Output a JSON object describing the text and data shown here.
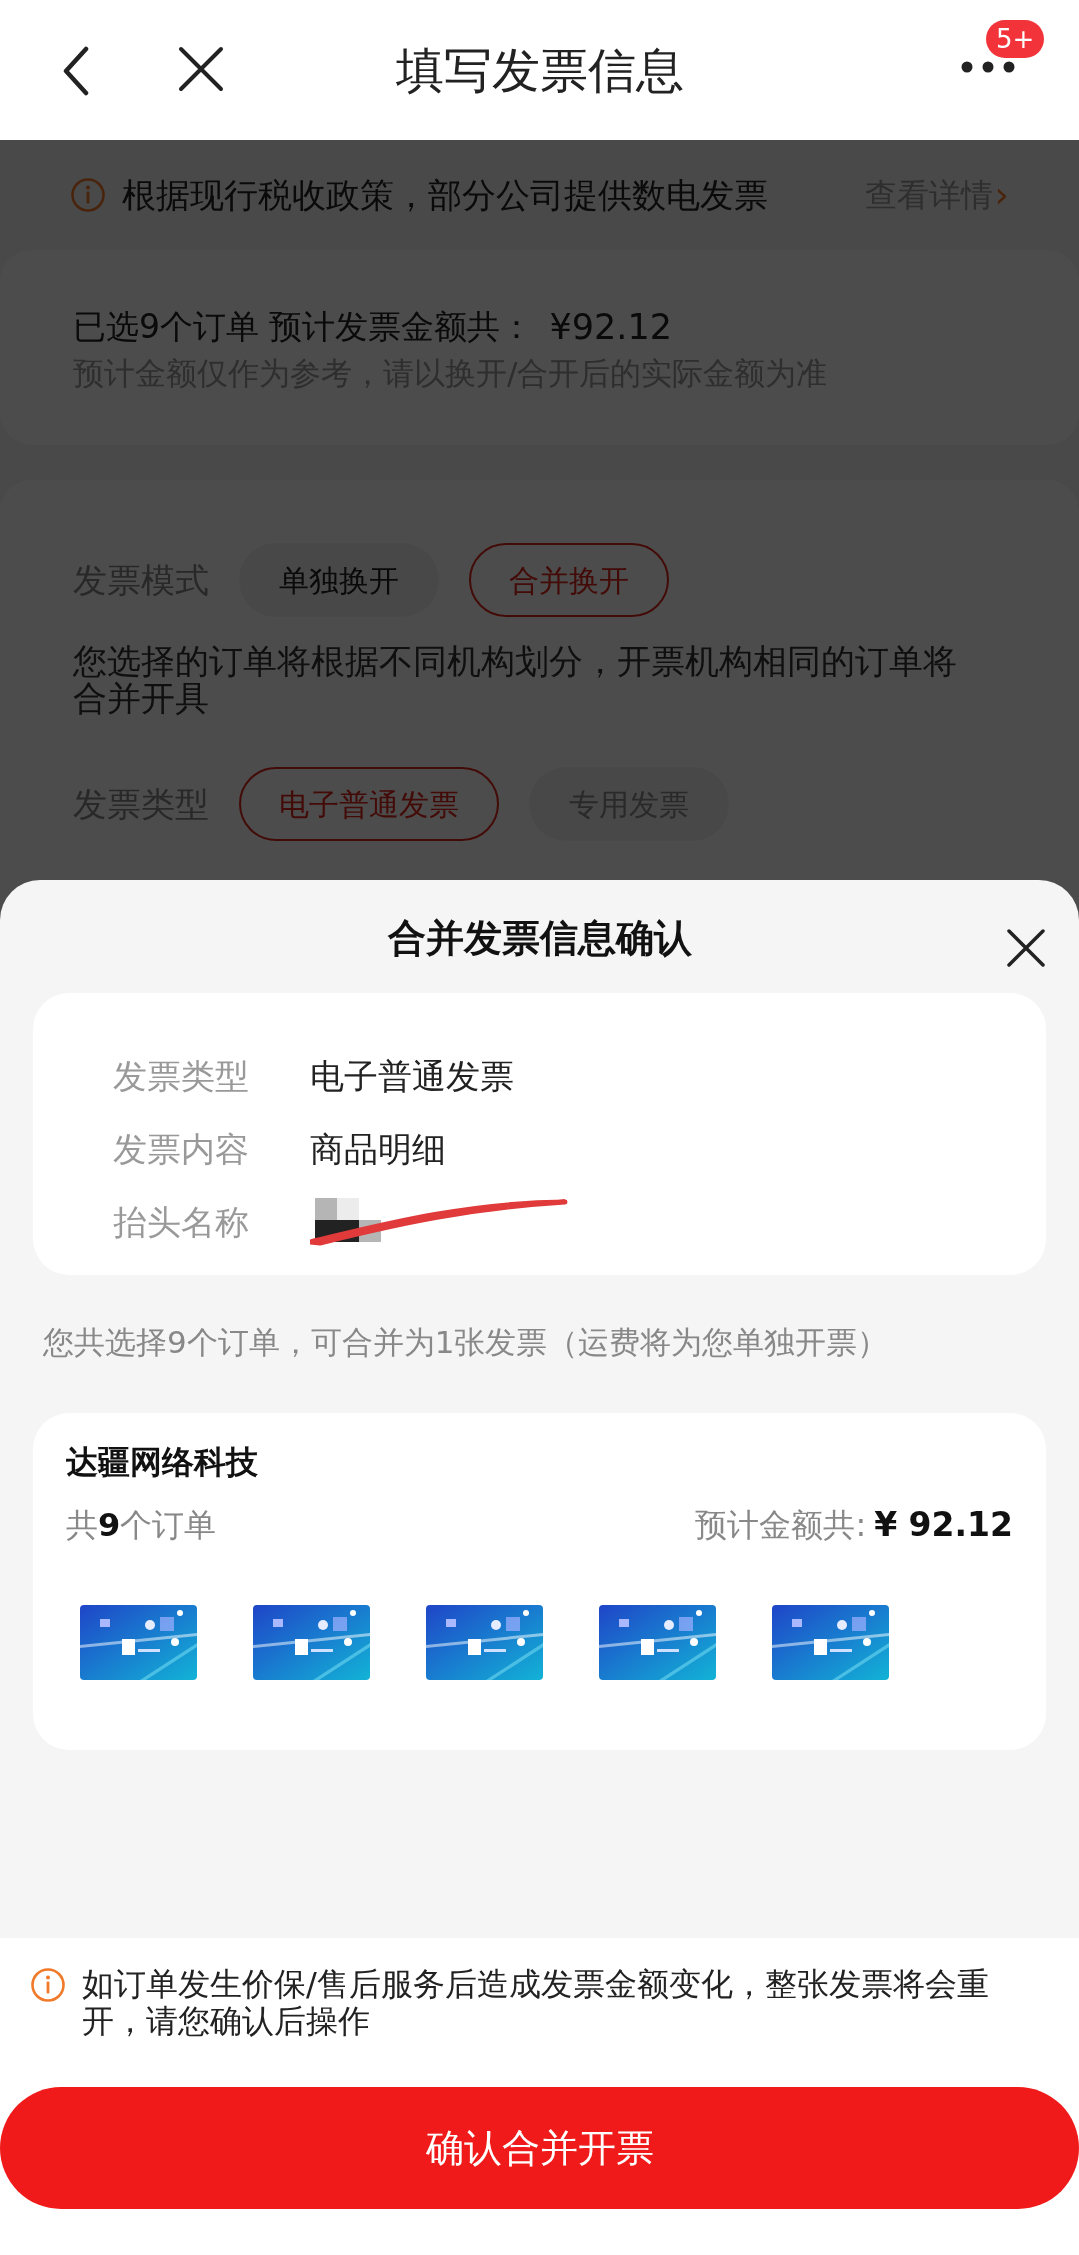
{
  "header": {
    "title": "填写发票信息",
    "badge": "5+"
  },
  "notice": {
    "text": "根据现行税收政策，部分公司提供数电发票",
    "link": "查看详情",
    "chevron": "›"
  },
  "summary": {
    "headline": "已选9个订单 预计发票金额共：",
    "amount": "¥92.12",
    "note": "预计金额仅作为参考，请以换开/合开后的实际金额为准"
  },
  "invoice_mode": {
    "label": "发票模式",
    "options": [
      {
        "label": "单独换开",
        "selected": false,
        "disabled": false
      },
      {
        "label": "合并换开",
        "selected": true,
        "disabled": false
      }
    ]
  },
  "mode_description": "您选择的订单将根据不同机构划分，开票机构相同的订单将合并开具",
  "invoice_type": {
    "label": "发票类型",
    "options": [
      {
        "label": "电子普通发票",
        "selected": true,
        "disabled": false
      },
      {
        "label": "专用发票",
        "selected": false,
        "disabled": true
      }
    ]
  },
  "sheet": {
    "title": "合并发票信息确认",
    "fields": [
      {
        "label": "发票类型",
        "value": "电子普通发票",
        "redacted": false
      },
      {
        "label": "发票内容",
        "value": "商品明细",
        "redacted": false
      },
      {
        "label": "抬头名称",
        "redacted": true
      }
    ],
    "summary": "您共选择9个订单，可合并为1张发票（运费将为您单独开票）",
    "shop": {
      "name": "达疆网络科技",
      "order_count": "共**9**个订单",
      "total_label": "预计金额共:",
      "total": "¥ 92.12"
    },
    "warning": "如订单发生价保/售后服务后造成发票金额变化，整张发票将会重开，请您确认后操作",
    "confirm_button": "确认合并开票"
  }
}
